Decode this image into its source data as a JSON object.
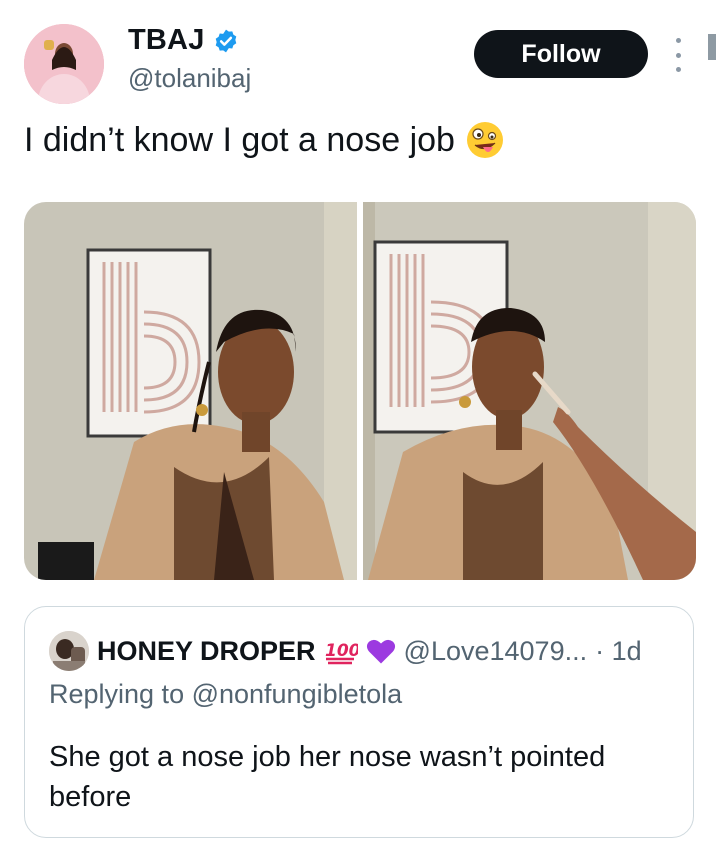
{
  "tweet": {
    "author": {
      "display_name": "TBAJ",
      "handle": "@tolanibaj",
      "verified": true
    },
    "follow_label": "Follow",
    "more_icon": "more-vertical-icon",
    "text": "I didn’t know I got a nose job",
    "emoji": "zany-face-emoji",
    "media": {
      "count": 2,
      "images": [
        "photo-before",
        "photo-after"
      ]
    }
  },
  "quote": {
    "author": {
      "display_name": "HONEY DROPER",
      "name_emojis": [
        "hundred-points-emoji",
        "purple-heart-emoji"
      ],
      "handle": "@Love14079...",
      "time": "· 1d"
    },
    "replying_to": "Replying to @nonfungibletola",
    "text": "She got a nose job her nose wasn’t pointed before"
  },
  "colors": {
    "follow_bg": "#0f1419",
    "verified": "#1d9bf0",
    "secondary_text": "#536471",
    "border": "#cfd9de"
  }
}
